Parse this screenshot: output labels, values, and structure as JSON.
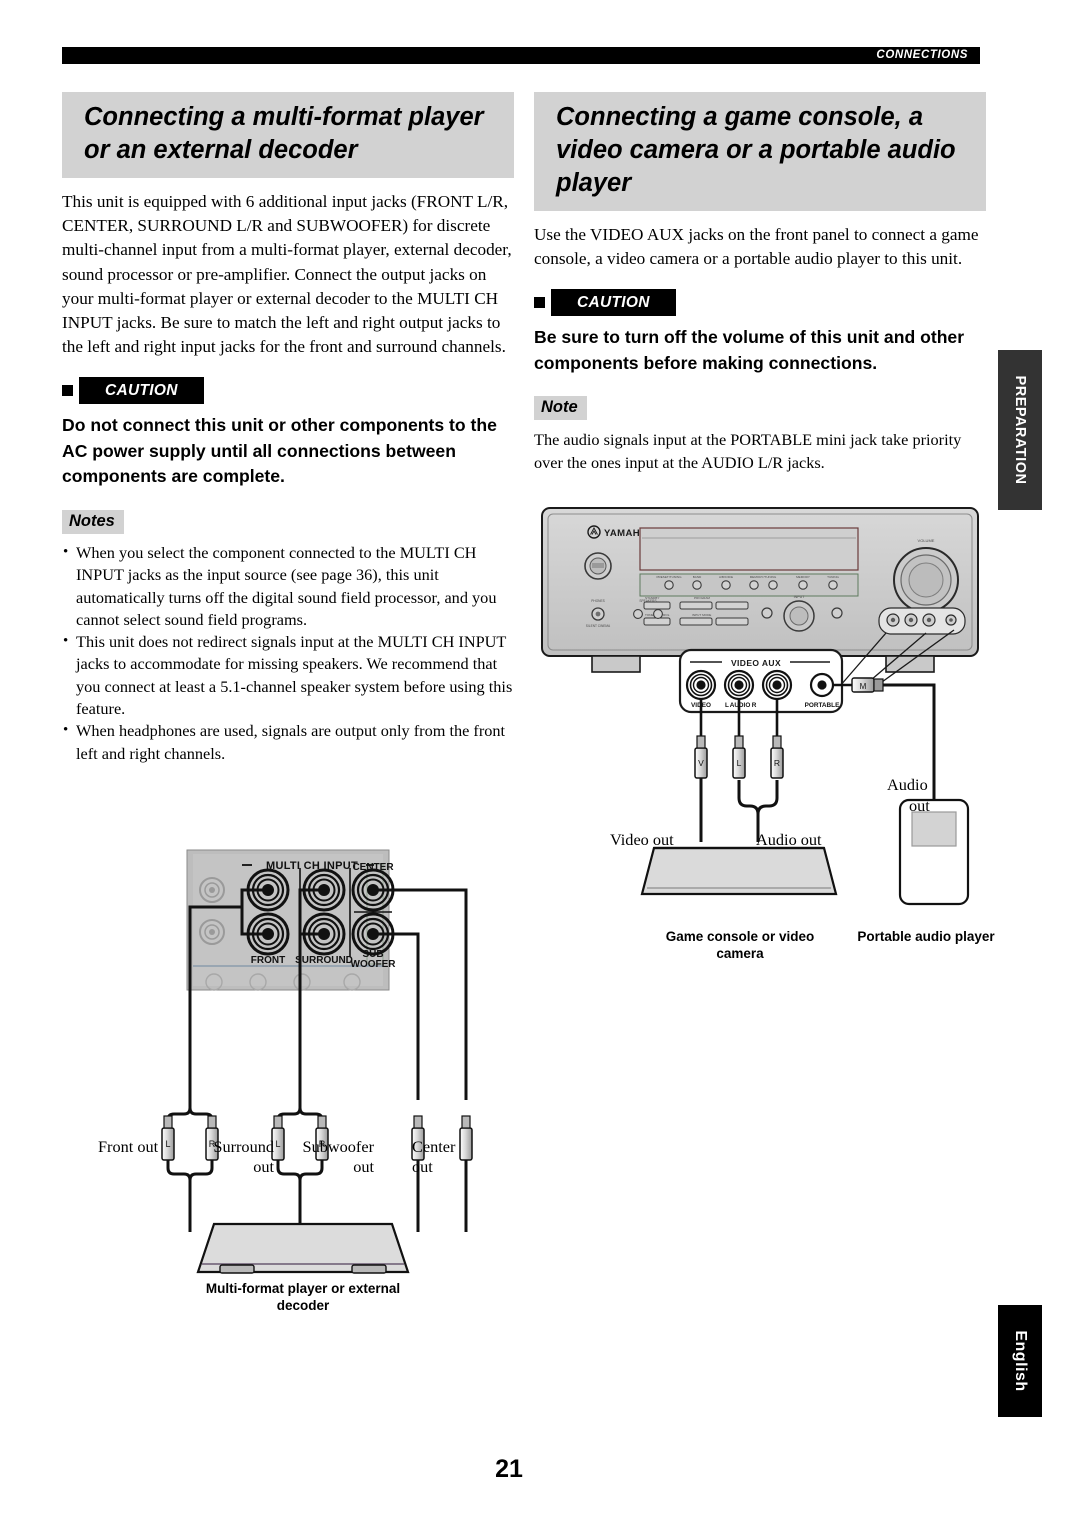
{
  "header": {
    "running_head": "CONNECTIONS"
  },
  "left_column": {
    "heading": "Connecting a multi-format player or an external decoder",
    "intro": "This unit is equipped with 6 additional input jacks (FRONT L/R, CENTER, SURROUND L/R and SUBWOOFER) for discrete multi-channel input from a multi-format player, external decoder, sound processor or pre-amplifier. Connect the output jacks on your multi-format player or external decoder to the MULTI CH INPUT jacks. Be sure to match the left and right output jacks to the left and right input jacks for the front and surround channels.",
    "caution_label": "CAUTION",
    "caution_text": "Do not connect this unit or other components to the AC power supply until all connections between components are complete.",
    "notes_label": "Notes",
    "notes": [
      "When you select the component connected to the MULTI CH INPUT jacks as the input source (see page 36), this unit automatically turns off the digital sound field processor, and you cannot select sound field programs.",
      "This unit does not redirect signals input at the MULTI CH INPUT jacks to accommodate for missing speakers. We recommend that you connect at least a 5.1-channel speaker system before using this feature.",
      "When headphones are used, signals are output only from the front left and right channels."
    ]
  },
  "right_column": {
    "heading": "Connecting a game console, a video camera or a portable audio player",
    "intro": "Use the VIDEO AUX jacks on the front panel to connect a game console, a video camera or a portable audio player to this unit.",
    "caution_label": "CAUTION",
    "caution_text": "Be sure to turn off the volume of this unit and other components before making connections.",
    "note_label": "Note",
    "note_text": "The audio signals input at the PORTABLE mini jack take priority over the ones input at the AUDIO L/R jacks."
  },
  "figure_left": {
    "panel_title": "MULTI CH INPUT",
    "jack_labels": {
      "center": "CENTER",
      "front": "FRONT",
      "surround": "SURROUND",
      "subwoofer_line1": "SUB",
      "subwoofer_line2": "WOOFER"
    },
    "plug_labels": {
      "left": "L",
      "right": "R"
    },
    "cable_labels": [
      "Front out",
      "Surround out",
      "Subwoofer out",
      "Center out"
    ],
    "caption": "Multi-format player or external decoder"
  },
  "figure_right": {
    "brand": "YAMAHA",
    "panel_title": "VIDEO AUX",
    "jack_labels": {
      "video": "VIDEO",
      "audio_l": "L",
      "audio": "AUDIO",
      "audio_r": "R",
      "portable": "PORTABLE"
    },
    "plug_labels": {
      "video": "V",
      "left": "L",
      "right": "R",
      "mini": "M"
    },
    "cable_labels": {
      "video_out": "Video out",
      "audio_out": "Audio out",
      "portable_audio_out_line1": "Audio",
      "portable_audio_out_line2": "out"
    },
    "captions": {
      "console": "Game console or video camera",
      "player": "Portable audio player"
    }
  },
  "side_tabs": {
    "preparation": "PREPARATION",
    "language": "English"
  },
  "page_number": "21",
  "colors": {
    "heading_bg": "#d2d2d2",
    "caution_bg": "#000000",
    "tab_prep_bg": "#333333",
    "tab_lang_bg": "#000000",
    "panel_gray": "#b9b9b9"
  }
}
